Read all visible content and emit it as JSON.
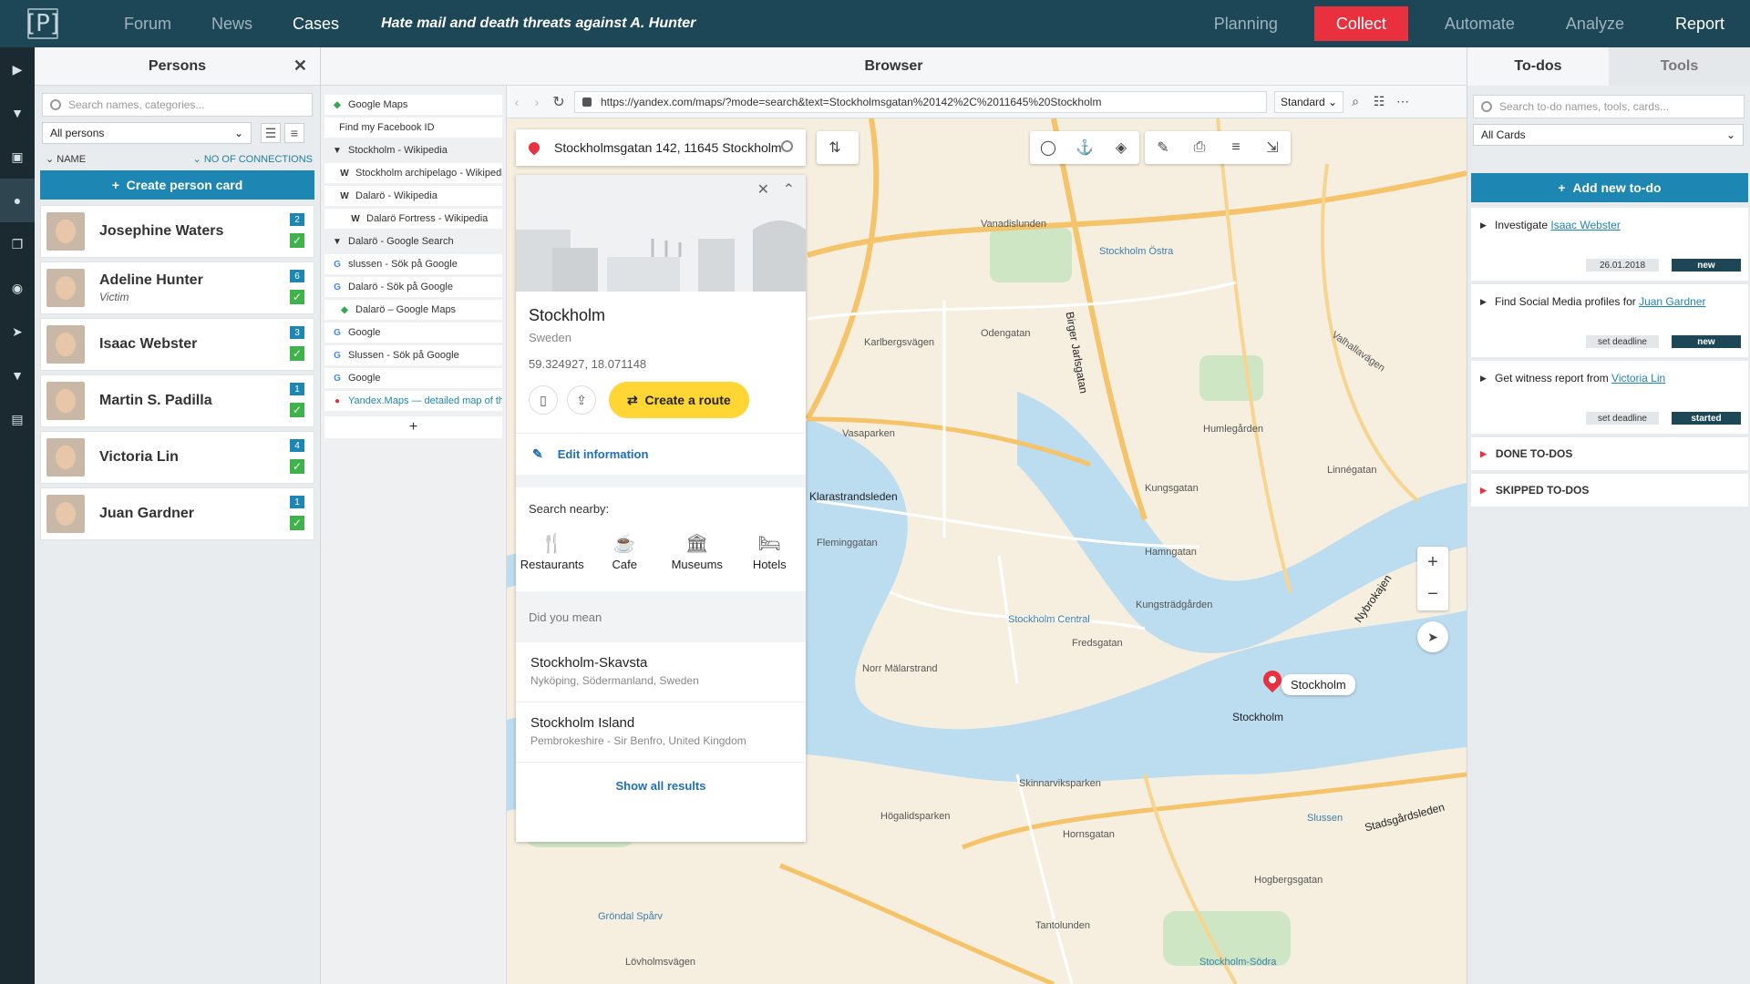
{
  "app": {
    "logo": "[P]"
  },
  "nav": {
    "left": [
      "Forum",
      "News",
      "Cases"
    ],
    "case_title": "Hate mail and death threats against A. Hunter",
    "right": [
      "Planning",
      "Collect",
      "Automate",
      "Analyze",
      "Report"
    ]
  },
  "persons": {
    "title": "Persons",
    "search_placeholder": "Search names, categories...",
    "filter": "All persons",
    "sort_left": "NAME",
    "sort_right": "NO OF CONNECTIONS",
    "create_label": "Create person card",
    "list": [
      {
        "name": "Josephine Waters",
        "sub": "",
        "count": "2"
      },
      {
        "name": "Adeline Hunter",
        "sub": "Victim",
        "count": "6"
      },
      {
        "name": "Isaac Webster",
        "sub": "",
        "count": "3"
      },
      {
        "name": "Martin S. Padilla",
        "sub": "",
        "count": "1"
      },
      {
        "name": "Victoria Lin",
        "sub": "",
        "count": "4"
      },
      {
        "name": "Juan Gardner",
        "sub": "",
        "count": "1"
      }
    ]
  },
  "browser": {
    "title": "Browser",
    "url": "https://yandex.com/maps/?mode=search&text=Stockholmsgatan%20142%2C%2011645%20Stockholm",
    "mode": "Standard",
    "tabs": [
      {
        "label": "Google Maps",
        "kind": "plain",
        "icon": "google-maps-icon"
      },
      {
        "label": "Find my Facebook ID",
        "kind": "child",
        "icon": ""
      },
      {
        "label": "Stockholm - Wikipedia",
        "kind": "group",
        "icon": ""
      },
      {
        "label": "Stockholm archipelago - Wikipedia",
        "kind": "child",
        "icon": "wikipedia-icon"
      },
      {
        "label": "Dalarö - Wikipedia",
        "kind": "child",
        "icon": "wikipedia-icon"
      },
      {
        "label": "Dalarö Fortress - Wikipedia",
        "kind": "child2",
        "icon": "wikipedia-icon"
      },
      {
        "label": "Dalarö - Google Search",
        "kind": "group",
        "icon": ""
      },
      {
        "label": "slussen - Sök på Google",
        "kind": "plain",
        "icon": "google-icon"
      },
      {
        "label": "Dalarö - Sök på Google",
        "kind": "plain",
        "icon": "google-icon"
      },
      {
        "label": "Dalarö – Google Maps",
        "kind": "child",
        "icon": "google-maps-icon"
      },
      {
        "label": "Google",
        "kind": "plain",
        "icon": "google-icon"
      },
      {
        "label": "Slussen - Sök på Google",
        "kind": "plain",
        "icon": "google-icon"
      },
      {
        "label": "Google",
        "kind": "plain",
        "icon": "google-icon"
      },
      {
        "label": "Yandex.Maps — detailed map of the",
        "kind": "active",
        "icon": "yandex-icon"
      }
    ],
    "tab_add": "+"
  },
  "place": {
    "search_value": "Stockholmsgatan 142, 11645 Stockholm",
    "name": "Stockholm",
    "country": "Sweden",
    "coords": "59.324927, 18.071148",
    "route_label": "Create a route",
    "edit_label": "Edit information",
    "nearby_title": "Search nearby:",
    "nearby": [
      "Restaurants",
      "Cafe",
      "Museums",
      "Hotels"
    ],
    "did_you_mean": "Did you mean",
    "suggestions": [
      {
        "name": "Stockholm-Skavsta",
        "sub": "Nyköping, Södermanland, Sweden"
      },
      {
        "name": "Stockholm Island",
        "sub": "Pembrokeshire - Sir Benfro, United Kingdom"
      }
    ],
    "show_all": "Show all results"
  },
  "map": {
    "pin_label": "Stockholm",
    "labels": [
      "Vanadislunden",
      "Stockholm Östra",
      "Karlbergsvägen",
      "Odengatan",
      "Vasaparken",
      "Klarastrandsleden",
      "Fleminggatan",
      "Humlegården",
      "Kungsgatan",
      "Hamngatan",
      "Stockholm Central",
      "Kungsträdgården",
      "Norr Mälarstrand",
      "Stockholm",
      "Skinnarviksparken",
      "Hornsgatan",
      "Högalidsparken",
      "Slussen",
      "Stadsgårdsleden",
      "Hogbergsgatan",
      "Tantolunden",
      "Stockholm-Södra",
      "Gröndal Spårv",
      "Lövholmsvägen",
      "Birger Jarlsgatan",
      "Valhallavägen",
      "Linnégatan",
      "Nybrokajen",
      "Fredsgatan"
    ],
    "zoom_in": "+",
    "zoom_out": "−"
  },
  "todos": {
    "tab_active": "To-dos",
    "tab_other": "Tools",
    "search_placeholder": "Search to-do names, tools, cards...",
    "filter": "All Cards",
    "add_label": "Add new to-do",
    "items": [
      {
        "text": "Investigate ",
        "link": "Isaac Webster",
        "deadline": "26.01.2018",
        "status": "new"
      },
      {
        "text": "Find Social Media profiles for ",
        "link": "Juan Gardner",
        "deadline": "set deadline",
        "status": "new"
      },
      {
        "text": "Get witness report from ",
        "link": "Victoria Lin",
        "deadline": "set deadline",
        "status": "started"
      }
    ],
    "sections": [
      "DONE TO-DOS",
      "SKIPPED TO-DOS"
    ]
  },
  "colors": {
    "nav_bg": "#1d4757",
    "accent": "#1e86b2",
    "collect": "#e8303e",
    "check": "#3fb24b"
  }
}
